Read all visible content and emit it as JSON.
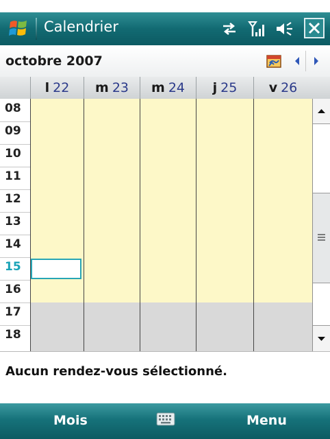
{
  "title_bar": {
    "app_title": "Calendrier",
    "icons": [
      "windows-start-icon",
      "connectivity-arrows-icon",
      "signal-strength-icon",
      "speaker-icon",
      "close-icon"
    ]
  },
  "header": {
    "month_label": "octobre 2007",
    "today_icon": "today-calendar-icon",
    "prev_icon": "triangle-left-icon",
    "next_icon": "triangle-right-icon"
  },
  "days": [
    {
      "letter": "l",
      "number": "22"
    },
    {
      "letter": "m",
      "number": "23"
    },
    {
      "letter": "m",
      "number": "24"
    },
    {
      "letter": "j",
      "number": "25"
    },
    {
      "letter": "v",
      "number": "26"
    }
  ],
  "hours": [
    "08",
    "09",
    "10",
    "11",
    "12",
    "13",
    "14",
    "15",
    "16",
    "17",
    "18"
  ],
  "selected_hour": "15",
  "colors": {
    "work_hours": "#fdf8c8",
    "off_hours": "#d9d9d9",
    "accent": "#1aa3b7",
    "bar": "#126a72"
  },
  "details": {
    "text": "Aucun rendez-vous sélectionné."
  },
  "softkeys": {
    "left": "Mois",
    "right": "Menu",
    "center_icon": "keyboard-icon"
  }
}
